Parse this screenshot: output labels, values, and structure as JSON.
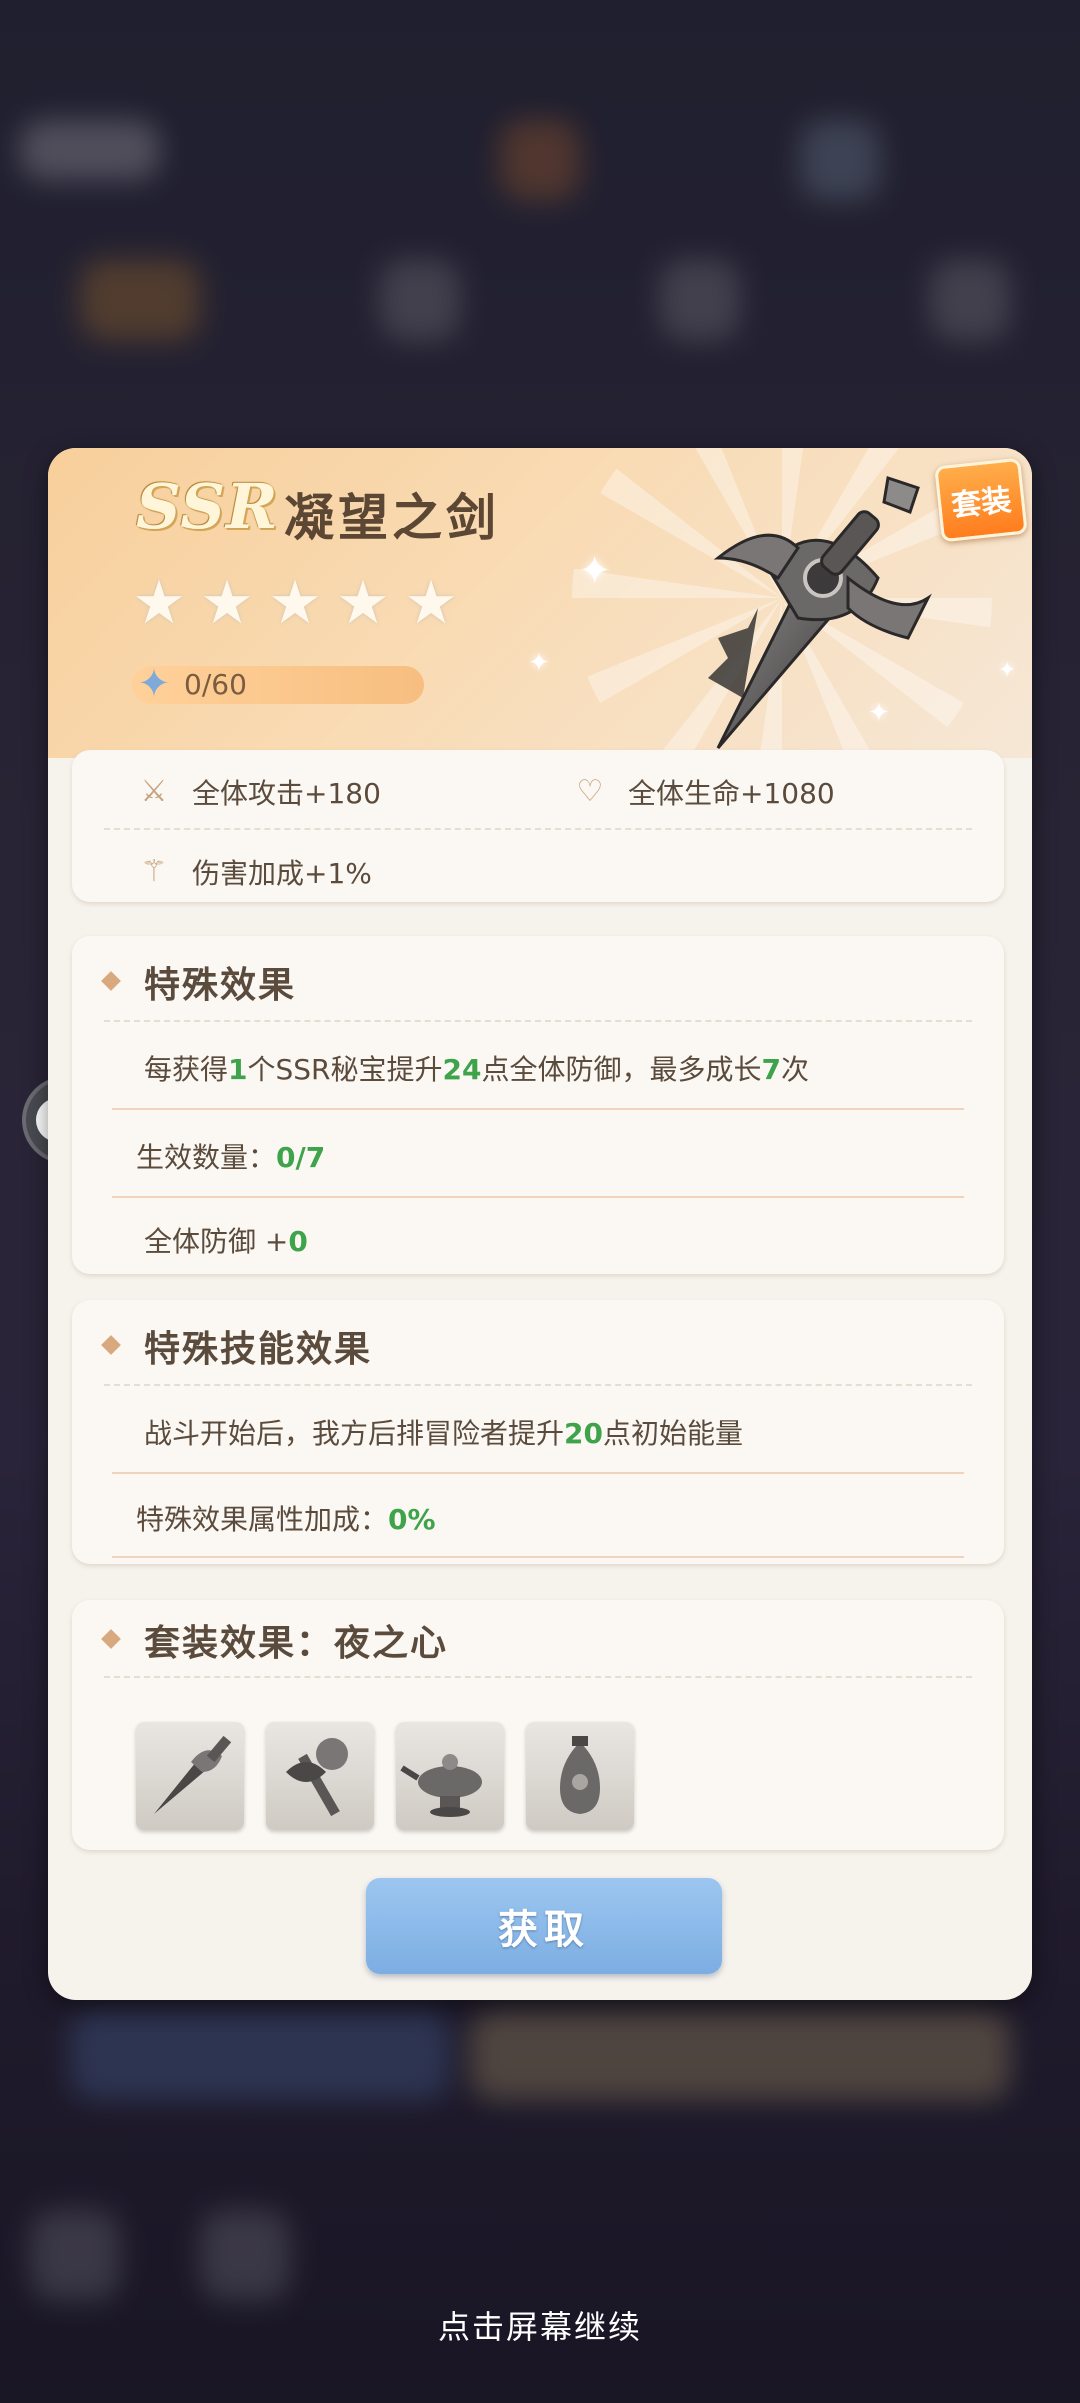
{
  "item": {
    "rarity": "SSR",
    "name": "凝望之剑",
    "stars_filled": 0,
    "stars_total": 5,
    "level_progress": "0/60",
    "set_badge": "套装"
  },
  "stats": [
    {
      "icon": "attack-icon",
      "label": "全体攻击+180"
    },
    {
      "icon": "heart-icon",
      "label": "全体生命+1080"
    },
    {
      "icon": "damage-bonus-icon",
      "label": "伤害加成+1%"
    }
  ],
  "special_effect": {
    "title": "特殊效果",
    "desc_parts": [
      "每获得",
      "1",
      "个SSR秘宝提升",
      "24",
      "点全体防御，最多成长",
      "7",
      "次"
    ],
    "active_count_label": "生效数量：",
    "active_count_value": "0/7",
    "defense_label": "全体防御 +",
    "defense_value": "0"
  },
  "special_skill": {
    "title": "特殊技能效果",
    "desc_parts": [
      "战斗开始后，我方后排冒险者提升",
      "20",
      "点初始能量"
    ],
    "bonus_label": "特殊效果属性加成：",
    "bonus_value": "0%"
  },
  "set_effect": {
    "title": "套装效果：夜之心",
    "items": [
      "sword-item-icon",
      "staff-item-icon",
      "lamp-item-icon",
      "vase-item-icon"
    ]
  },
  "buttons": {
    "obtain": "获取"
  },
  "footer": {
    "continue": "点击屏幕继续"
  },
  "colors": {
    "highlight_green": "#3ea34a",
    "button_blue": "#8bbbe9",
    "set_badge_orange": "#ff8a26"
  }
}
